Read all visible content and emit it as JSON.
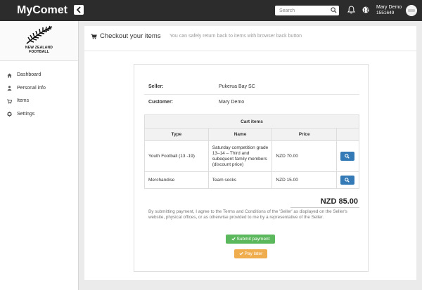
{
  "app": {
    "brand": "MyComet"
  },
  "header": {
    "search_placeholder": "Search",
    "user": {
      "name": "Mary Demo",
      "id": "1551649"
    }
  },
  "sidebar": {
    "logo": {
      "line1": "NEW ZEALAND",
      "line2": "FOOTBALL"
    },
    "items": [
      {
        "label": "Dashboard",
        "icon": "dashboard-icon"
      },
      {
        "label": "Personal info",
        "icon": "user-icon"
      },
      {
        "label": "Items",
        "icon": "cart-icon"
      },
      {
        "label": "Settings",
        "icon": "gear-icon"
      }
    ]
  },
  "page": {
    "title": "Checkout your items",
    "subtitle": "You can safely return back to items with browser back button"
  },
  "checkout": {
    "seller_label": "Seller:",
    "seller": "Pukerua Bay SC",
    "customer_label": "Customer:",
    "customer": "Mary Demo",
    "cart_caption": "Cart items",
    "columns": [
      "Type",
      "Name",
      "Price",
      ""
    ],
    "rows": [
      {
        "type": "Youth Football (13 -19)",
        "name": "Saturday competition grade 13–14 – Third and subequent family members (discount price)",
        "price": "NZD 70.00"
      },
      {
        "type": "Merchandise",
        "name": "Team socks",
        "price": "NZD 15.00"
      }
    ],
    "total": "NZD 85.00",
    "terms": "By submitting payment, I agree to the Terms and Conditions of the 'Seller' as displayed on the Seller's website, physical offices, or as otherwise provided to me by a representative of the Seller.",
    "submit_label": "Submit payment",
    "later_label": "Pay later"
  },
  "colors": {
    "topbar": "#2c2c2c",
    "primary": "#337ab7",
    "success": "#5cb85c",
    "warning": "#f0ad4e"
  }
}
